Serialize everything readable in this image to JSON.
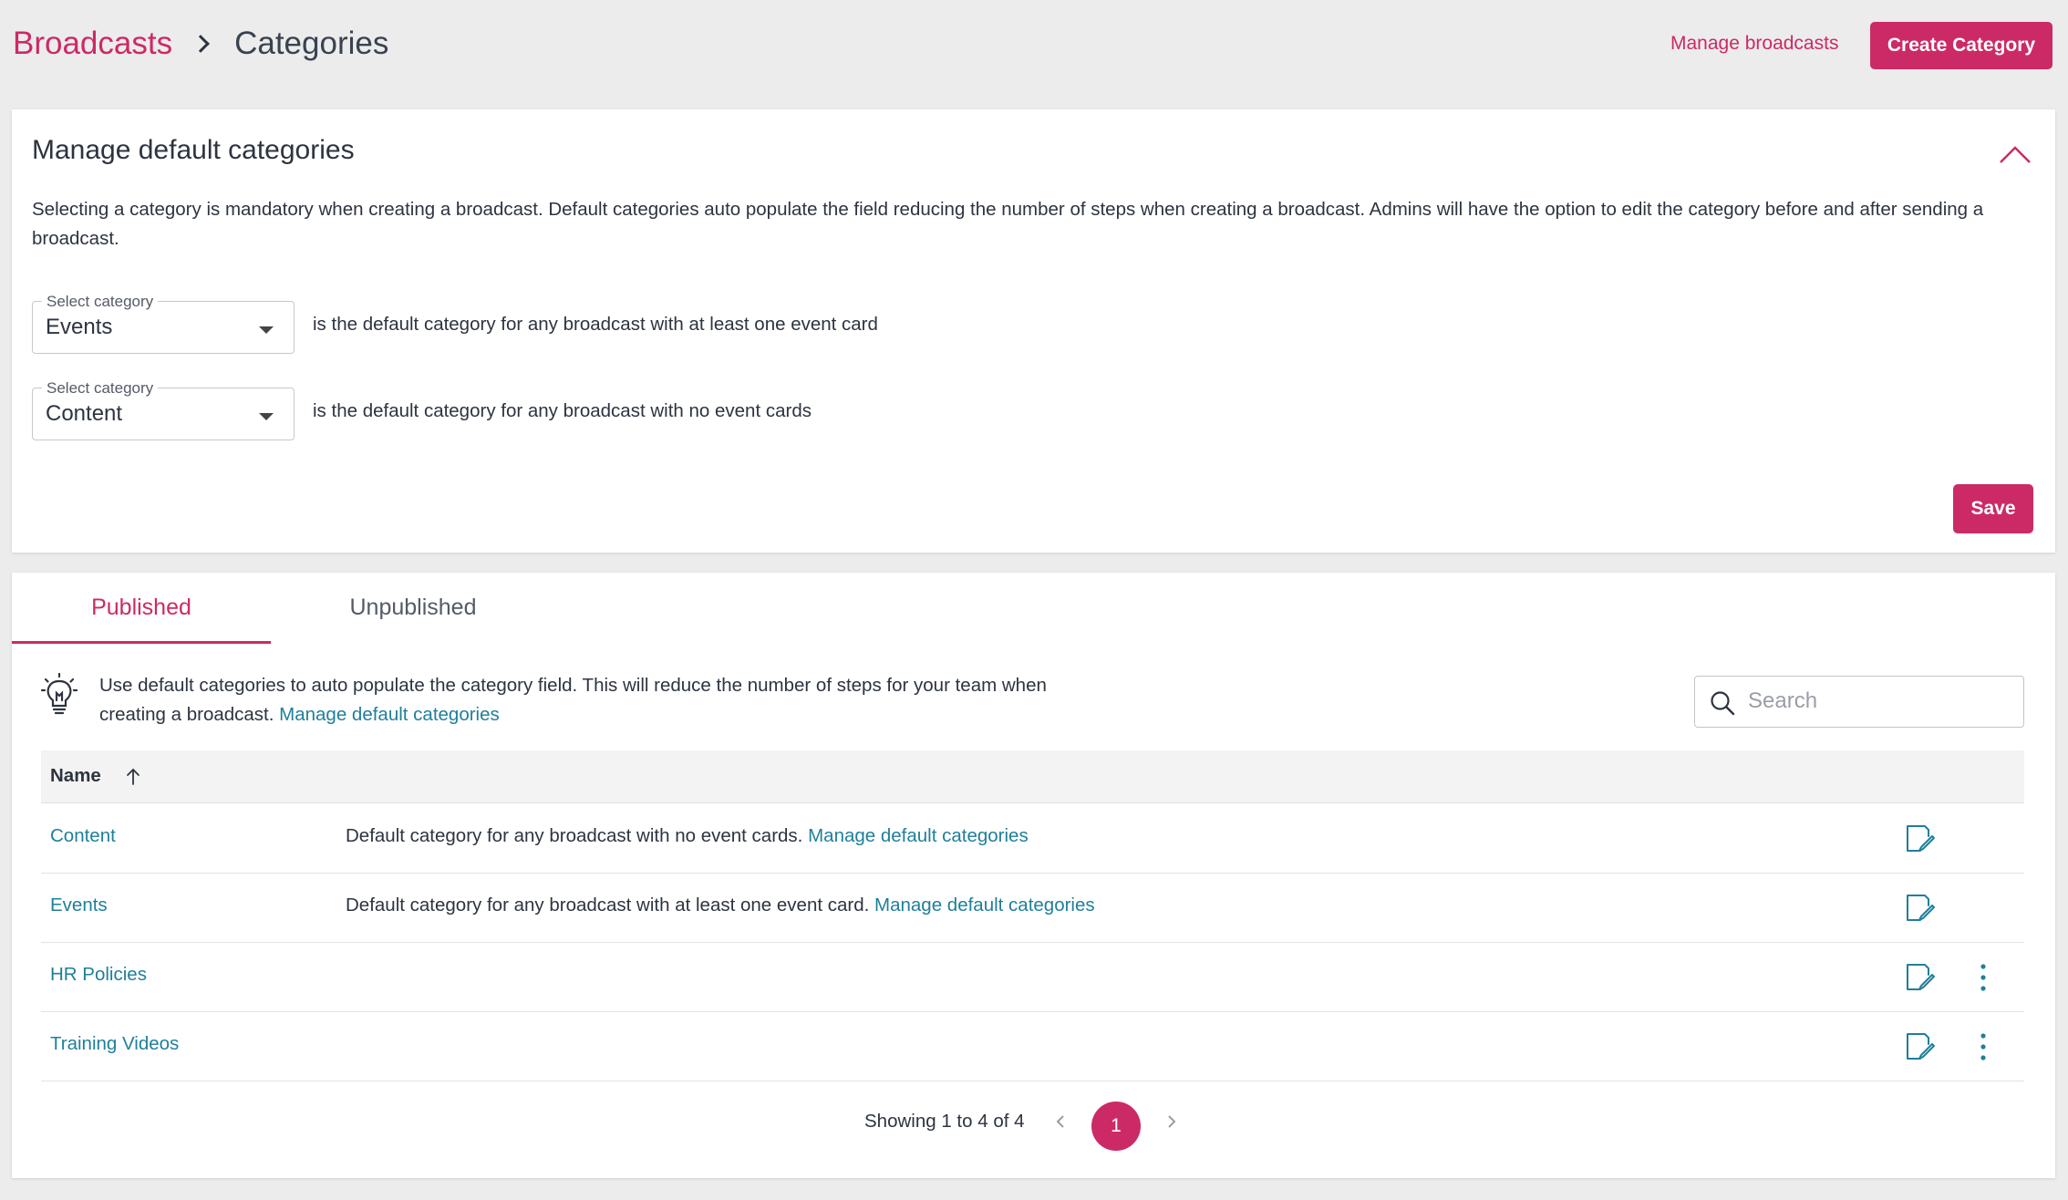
{
  "breadcrumb": {
    "root": "Broadcasts",
    "current": "Categories"
  },
  "header": {
    "manage_link": "Manage broadcasts",
    "create_button": "Create Category"
  },
  "defaults_panel": {
    "title": "Manage default categories",
    "description": "Selecting a category is mandatory when creating a broadcast. Default categories auto populate the field reducing the number of steps when creating a broadcast. Admins will have the option to edit the category before and after sending a broadcast.",
    "selects": [
      {
        "label": "Select category",
        "value": "Events",
        "text": "is the default category for any broadcast with at least one event card"
      },
      {
        "label": "Select category",
        "value": "Content",
        "text": "is the default category for any broadcast with no event cards"
      }
    ],
    "save_button": "Save"
  },
  "tabs": [
    {
      "label": "Published",
      "active": true
    },
    {
      "label": "Unpublished",
      "active": false
    }
  ],
  "hint": {
    "text": "Use default categories to auto populate the category field. This will reduce the number of steps for your team when creating a broadcast.",
    "link": "Manage default categories"
  },
  "search": {
    "placeholder": "Search",
    "value": ""
  },
  "table": {
    "columns": [
      "Name"
    ],
    "sort": "ascending",
    "rows": [
      {
        "name": "Content",
        "desc": "Default category for any broadcast with no event cards.",
        "link": "Manage default categories",
        "has_menu": false
      },
      {
        "name": "Events",
        "desc": "Default category for any broadcast with at least one event card.",
        "link": "Manage default categories",
        "has_menu": false
      },
      {
        "name": "HR Policies",
        "desc": "",
        "link": "",
        "has_menu": true
      },
      {
        "name": "Training Videos",
        "desc": "",
        "link": "",
        "has_menu": true
      }
    ]
  },
  "pagination": {
    "text": "Showing 1 to 4 of 4",
    "current_page": "1"
  },
  "colors": {
    "accent": "#cc2a66",
    "link": "#1f7f9a",
    "background": "#ececec",
    "text": "#2d3440"
  }
}
